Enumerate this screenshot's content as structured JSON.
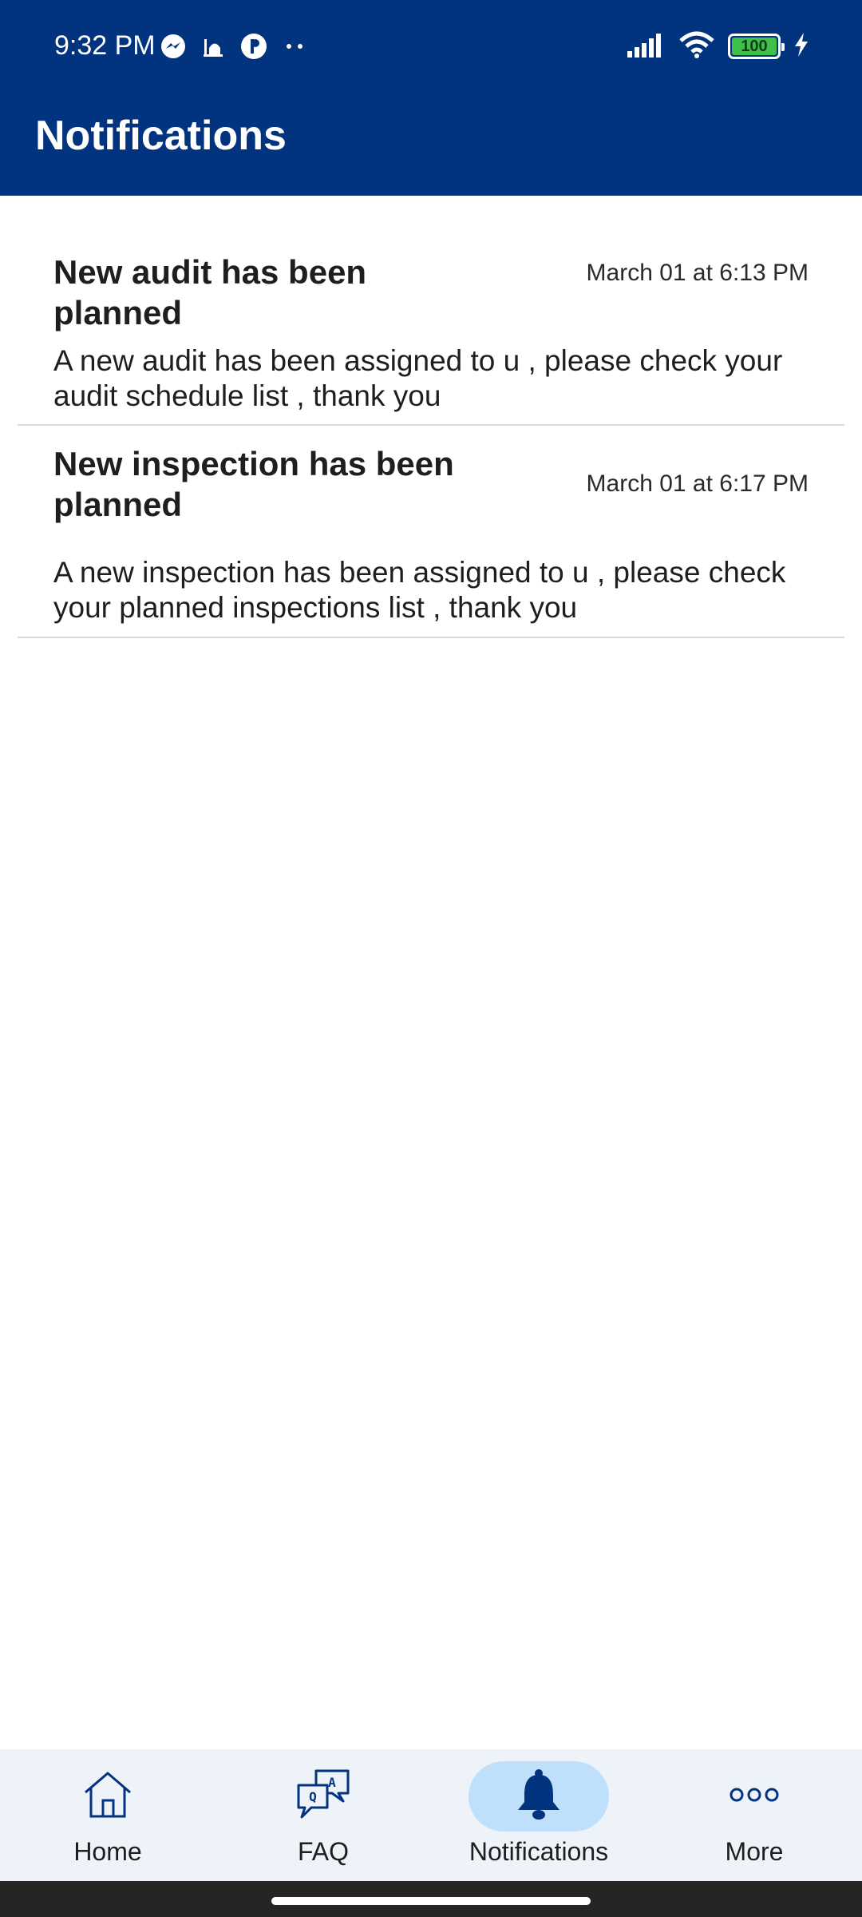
{
  "status_bar": {
    "time": "9:32 PM",
    "battery_level": "100",
    "left_icons": [
      "messenger-icon",
      "mosque-icon",
      "circle-app-icon",
      "more-dots-icon"
    ],
    "right_icons": [
      "signal-icon",
      "wifi-icon",
      "battery-icon",
      "charging-icon"
    ]
  },
  "header": {
    "title": "Notifications",
    "background_color": "#01337f"
  },
  "notifications": [
    {
      "title": "New audit has been planned",
      "time": "March 01 at 6:13 PM",
      "body": "A new audit has been assigned to u , please check your audit schedule list , thank you"
    },
    {
      "title": "New inspection has been planned",
      "time": "March 01 at 6:17 PM",
      "body": "A new inspection has been assigned to u , please check your planned inspections list , thank you"
    }
  ],
  "bottom_nav": {
    "items": [
      {
        "label": "Home",
        "icon": "home-icon",
        "active": false
      },
      {
        "label": "FAQ",
        "icon": "faq-icon",
        "active": false
      },
      {
        "label": "Notifications",
        "icon": "bell-icon",
        "active": true
      },
      {
        "label": "More",
        "icon": "more-icon",
        "active": false
      }
    ],
    "accent_color": "#01337f",
    "active_pill_color": "#bfe0fb"
  }
}
